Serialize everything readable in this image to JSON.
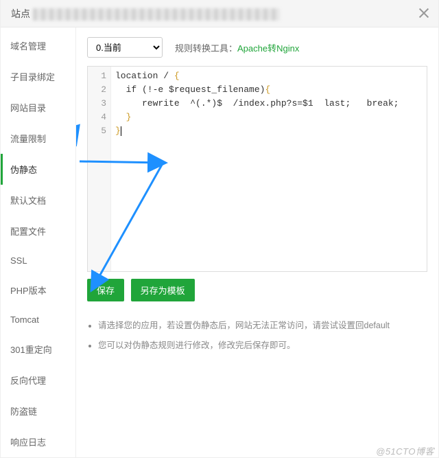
{
  "header": {
    "prefix": "站点"
  },
  "sidebar": {
    "items": [
      {
        "label": "域名管理"
      },
      {
        "label": "子目录绑定"
      },
      {
        "label": "网站目录"
      },
      {
        "label": "流量限制"
      },
      {
        "label": "伪静态"
      },
      {
        "label": "默认文档"
      },
      {
        "label": "配置文件"
      },
      {
        "label": "SSL"
      },
      {
        "label": "PHP版本"
      },
      {
        "label": "Tomcat"
      },
      {
        "label": "301重定向"
      },
      {
        "label": "反向代理"
      },
      {
        "label": "防盗链"
      },
      {
        "label": "响应日志"
      }
    ],
    "active_index": 4
  },
  "top": {
    "select_value": "0.当前",
    "tool_label": "规则转换工具：",
    "tool_link": "Apache转Nginx"
  },
  "code": {
    "lines": [
      "location / {",
      "  if (!-e $request_filename){",
      "     rewrite  ^(.*)$  /index.php?s=$1  last;   break;",
      "  }",
      "}"
    ]
  },
  "buttons": {
    "save": "保存",
    "save_as": "另存为模板"
  },
  "notes": {
    "n1": "请选择您的应用，若设置伪静态后，网站无法正常访问，请尝试设置回default",
    "n2": "您可以对伪静态规则进行修改，修改完后保存即可。"
  },
  "watermark": "@51CTO博客"
}
